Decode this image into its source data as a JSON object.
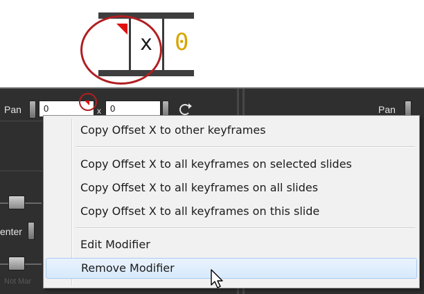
{
  "zoom_inset": {
    "multiplier": "x",
    "value": "0"
  },
  "panel_left": {
    "label": "Pan",
    "offset_x": "0",
    "multiplier": "x",
    "offset_y": "0"
  },
  "panel_right": {
    "label": "Pan"
  },
  "side_label": "enter",
  "watermark": "Not Mar",
  "context_menu": {
    "items": [
      "Copy Offset X to other keyframes",
      "Copy Offset X to all keyframes on selected slides",
      "Copy Offset X to all keyframes on all slides",
      "Copy Offset X to all keyframes on this slide",
      "Edit Modifier",
      "Remove Modifier"
    ]
  },
  "colors": {
    "panel_bg": "#2f2f2f",
    "highlight_circle": "#b01f22",
    "keyframe_flag": "#e01010",
    "menu_bg": "#f1f1f1",
    "menu_hover": "#d7e9fc"
  }
}
